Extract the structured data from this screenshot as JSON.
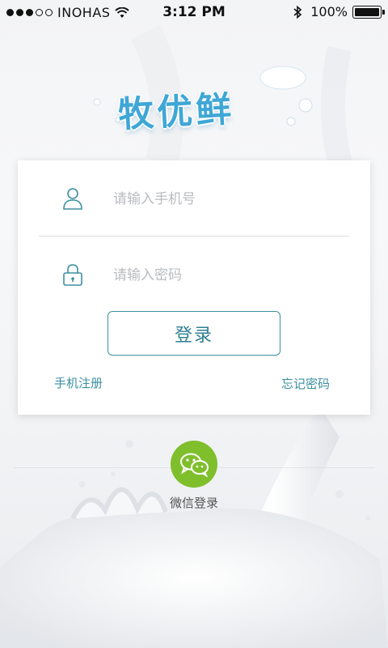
{
  "status_bar": {
    "carrier": "INOHAS",
    "time": "3:12 PM",
    "battery_percent": "100%",
    "battery_level": 1.0
  },
  "logo": {
    "text": "牧优鲜"
  },
  "login_form": {
    "phone_placeholder": "请输入手机号",
    "password_placeholder": "请输入密码",
    "login_label": "登录",
    "register_label": "手机注册",
    "forgot_label": "忘记密码"
  },
  "wechat": {
    "label": "微信登录"
  },
  "colors": {
    "accent": "#3d8fa0",
    "logo": "#3fa7d6",
    "wechat_green": "#7fbf2c"
  },
  "icons": [
    "wifi-icon",
    "bluetooth-icon",
    "battery-icon",
    "user-icon",
    "lock-icon",
    "wechat-icon"
  ]
}
